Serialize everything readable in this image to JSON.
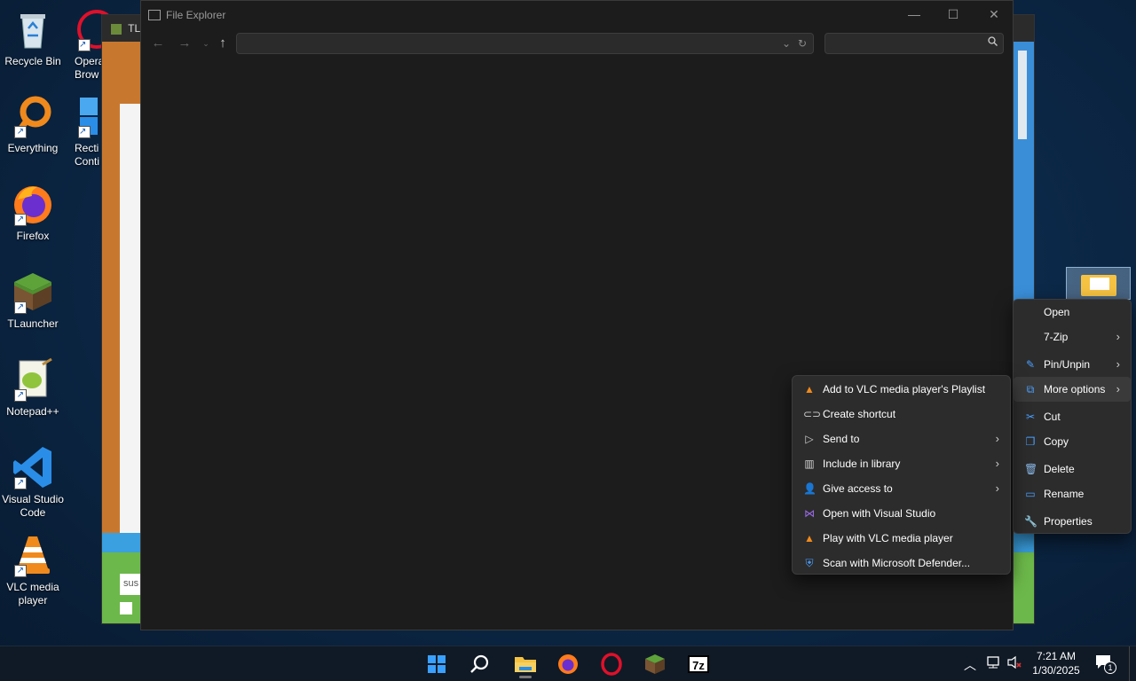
{
  "desktop": {
    "icons": [
      {
        "label": "Recycle Bin"
      },
      {
        "label": "Everything"
      },
      {
        "label": "Firefox"
      },
      {
        "label": "TLauncher"
      },
      {
        "label": "Notepad++"
      },
      {
        "label": "Visual Studio Code"
      },
      {
        "label": "VLC media player"
      }
    ],
    "partial_icons": [
      {
        "label": "Opera Brow"
      },
      {
        "label": "Recti Conti"
      }
    ]
  },
  "background_window": {
    "title": "TL",
    "input_text": "sus"
  },
  "explorer": {
    "title": "File Explorer",
    "address_value": "",
    "search_value": "",
    "controls": {
      "minimize": "—",
      "maximize": "☐",
      "close": "✕"
    }
  },
  "context_menu": {
    "items": [
      {
        "label": "Open",
        "icon": "none",
        "has_submenu": false
      },
      {
        "label": "7-Zip",
        "icon": "none",
        "has_submenu": true
      },
      {
        "label": "Pin/Unpin",
        "icon": "pin-icon",
        "has_submenu": true
      },
      {
        "label": "More options",
        "icon": "more-options-icon",
        "has_submenu": true,
        "highlighted": true
      },
      {
        "label": "Cut",
        "icon": "scissors-icon",
        "has_submenu": false
      },
      {
        "label": "Copy",
        "icon": "copy-icon",
        "has_submenu": false
      },
      {
        "label": "Delete",
        "icon": "trash-icon",
        "has_submenu": false
      },
      {
        "label": "Rename",
        "icon": "rename-icon",
        "has_submenu": false
      },
      {
        "label": "Properties",
        "icon": "wrench-icon",
        "has_submenu": false
      }
    ]
  },
  "more_options_menu": {
    "items": [
      {
        "label": "Add to VLC media player's Playlist",
        "icon": "vlc-icon",
        "has_submenu": false
      },
      {
        "label": "Create shortcut",
        "icon": "link-icon",
        "has_submenu": false
      },
      {
        "label": "Send to",
        "icon": "send-icon",
        "has_submenu": true
      },
      {
        "label": "Include in library",
        "icon": "library-icon",
        "has_submenu": true
      },
      {
        "label": "Give access to",
        "icon": "share-user-icon",
        "has_submenu": true
      },
      {
        "label": "Open with Visual Studio",
        "icon": "visual-studio-icon",
        "has_submenu": false
      },
      {
        "label": "Play with VLC media player",
        "icon": "vlc-icon",
        "has_submenu": false
      },
      {
        "label": "Scan with Microsoft Defender...",
        "icon": "defender-icon",
        "has_submenu": false
      }
    ]
  },
  "taskbar": {
    "apps": [
      "start-icon",
      "search-icon",
      "file-explorer-icon",
      "firefox-icon",
      "opera-icon",
      "tlauncher-icon",
      "7zip-icon"
    ],
    "seven_zip_label": "7z",
    "time": "7:21 AM",
    "date": "1/30/2025",
    "notification_count": "1"
  },
  "colors": {
    "menu_bg": "#2c2c2c",
    "explorer_bg": "#1c1c1c",
    "taskbar_bg": "#101a26"
  }
}
